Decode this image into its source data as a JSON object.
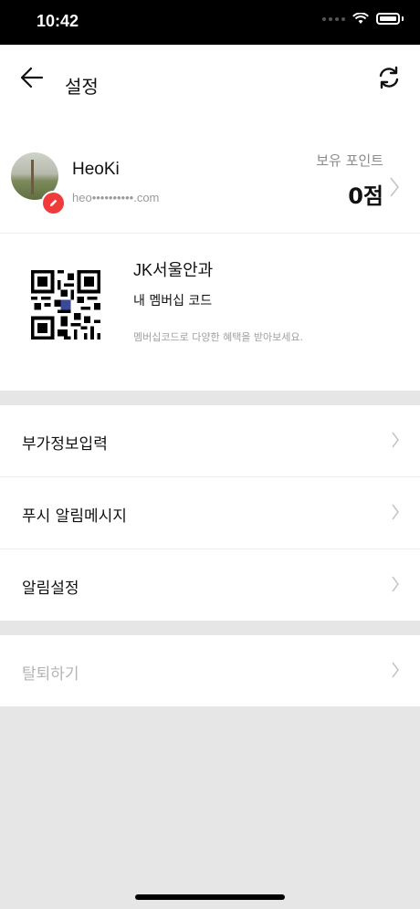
{
  "status_bar": {
    "time": "10:42"
  },
  "header": {
    "title": "설정"
  },
  "profile": {
    "name": "HeoKi",
    "email": "heo••••••••••.com",
    "points_label": "보유 포인트",
    "points_value": "0점"
  },
  "membership": {
    "store_name": "JK서울안과",
    "code_label": "내 멤버십 코드",
    "description": "멤버십코드로 다양한 혜택을 받아보세요."
  },
  "menu": {
    "items": [
      {
        "label": "부가정보입력"
      },
      {
        "label": "푸시 알림메시지"
      },
      {
        "label": "알림설정"
      }
    ],
    "withdraw_label": "탈퇴하기"
  },
  "colors": {
    "accent": "#ef3b3b",
    "background": "#e6e6e6",
    "disabled_text": "#b4b4b4"
  }
}
